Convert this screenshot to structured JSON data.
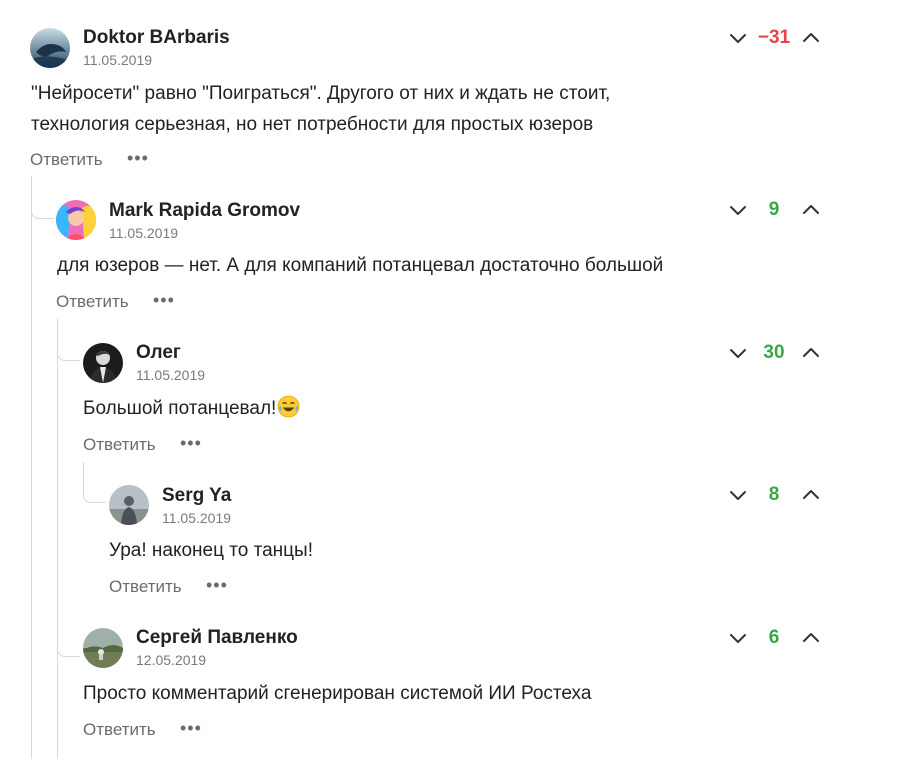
{
  "colors": {
    "negative": "#e54545",
    "positive": "#3aa64a",
    "muted": "#7a7a7a",
    "thread_line": "#d9d9d9"
  },
  "comments": [
    {
      "author": "Doktor BArbaris",
      "date": "11.05.2019",
      "text_lines": [
        "\"Нейросети\" равно \"Поиграться\". Другого от них и ждать не стоит,",
        "технология серьезная, но нет потребности для простых юзеров"
      ],
      "score": "−31",
      "reply": "Ответить",
      "more": "•••",
      "avatar_icon": "dolphin-avatar"
    },
    {
      "author": "Mark Rapida Gromov",
      "date": "11.05.2019",
      "text_lines": [
        "для юзеров — нет. А для компаний потанцевал достаточно большой"
      ],
      "score": "9",
      "reply": "Ответить",
      "more": "•••",
      "avatar_icon": "rainbow-hair-avatar"
    },
    {
      "author": "Олег",
      "date": "11.05.2019",
      "text_lines": [
        "Большой потанцевал!"
      ],
      "emoji": "laughing-tears-emoji",
      "score": "30",
      "reply": "Ответить",
      "more": "•••",
      "avatar_icon": "suited-man-avatar"
    },
    {
      "author": "Serg Ya",
      "date": "11.05.2019",
      "text_lines": [
        "Ура! наконец то танцы!"
      ],
      "score": "8",
      "reply": "Ответить",
      "more": "•••",
      "avatar_icon": "person-landscape-avatar"
    },
    {
      "author": "Сергей Павленко",
      "date": "12.05.2019",
      "text_lines": [
        "Просто комментарий сгенерирован системой ИИ Ростеха"
      ],
      "score": "6",
      "reply": "Ответить",
      "more": "•••",
      "avatar_icon": "field-landscape-avatar"
    }
  ]
}
